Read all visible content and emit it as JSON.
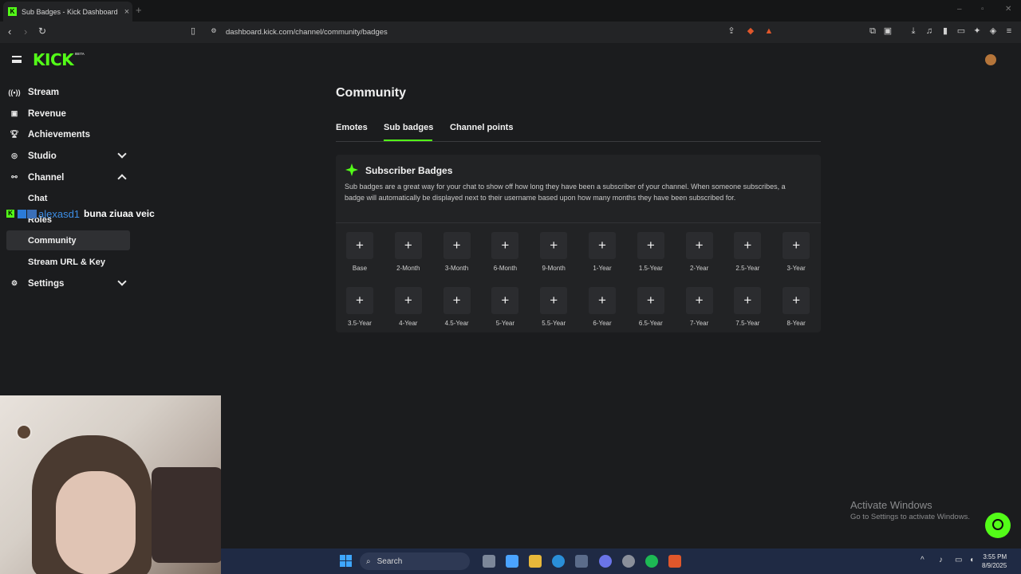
{
  "browser": {
    "tab_title": "Sub Badges - Kick Dashboard",
    "url": "dashboard.kick.com/channel/community/badges"
  },
  "header": {
    "logo": "KICK",
    "beta": "BETA"
  },
  "sidebar": {
    "items": [
      {
        "label": "Stream",
        "icon": "broadcast-icon"
      },
      {
        "label": "Revenue",
        "icon": "revenue-icon"
      },
      {
        "label": "Achievements",
        "icon": "trophy-icon"
      },
      {
        "label": "Studio",
        "icon": "studio-icon"
      },
      {
        "label": "Channel",
        "icon": "channel-icon"
      },
      {
        "label": "Chat"
      },
      {
        "label": "Roles"
      },
      {
        "label": "Community"
      },
      {
        "label": "Stream URL & Key"
      },
      {
        "label": "Settings",
        "icon": "gear-icon"
      }
    ]
  },
  "overlay": {
    "username": "alexasd1",
    "message": "buna ziuaa veic"
  },
  "main": {
    "heading": "Community",
    "tabs": [
      "Emotes",
      "Sub badges",
      "Channel points"
    ],
    "active_tab": "Sub badges",
    "card": {
      "title": "Subscriber Badges",
      "description": "Sub badges are a great way for your chat to show off how long they have been a subscriber of your channel. When someone subscribes, a badge will automatically be displayed next to their username based upon how many months they have been subscribed for.",
      "badges": [
        "Base",
        "2-Month",
        "3-Month",
        "6-Month",
        "9-Month",
        "1-Year",
        "1.5-Year",
        "2-Year",
        "2.5-Year",
        "3-Year",
        "3.5-Year",
        "4-Year",
        "4.5-Year",
        "5-Year",
        "5.5-Year",
        "6-Year",
        "6.5-Year",
        "7-Year",
        "7.5-Year",
        "8-Year"
      ],
      "add_symbol": "+"
    }
  },
  "watermark": {
    "line1": "Activate Windows",
    "line2": "Go to Settings to activate Windows."
  },
  "taskbar": {
    "search": "Search",
    "time": "3:55 PM",
    "date": "8/9/2025"
  },
  "colors": {
    "accent": "#53fc18",
    "background": "#1b1c1e",
    "card": "#222325"
  }
}
